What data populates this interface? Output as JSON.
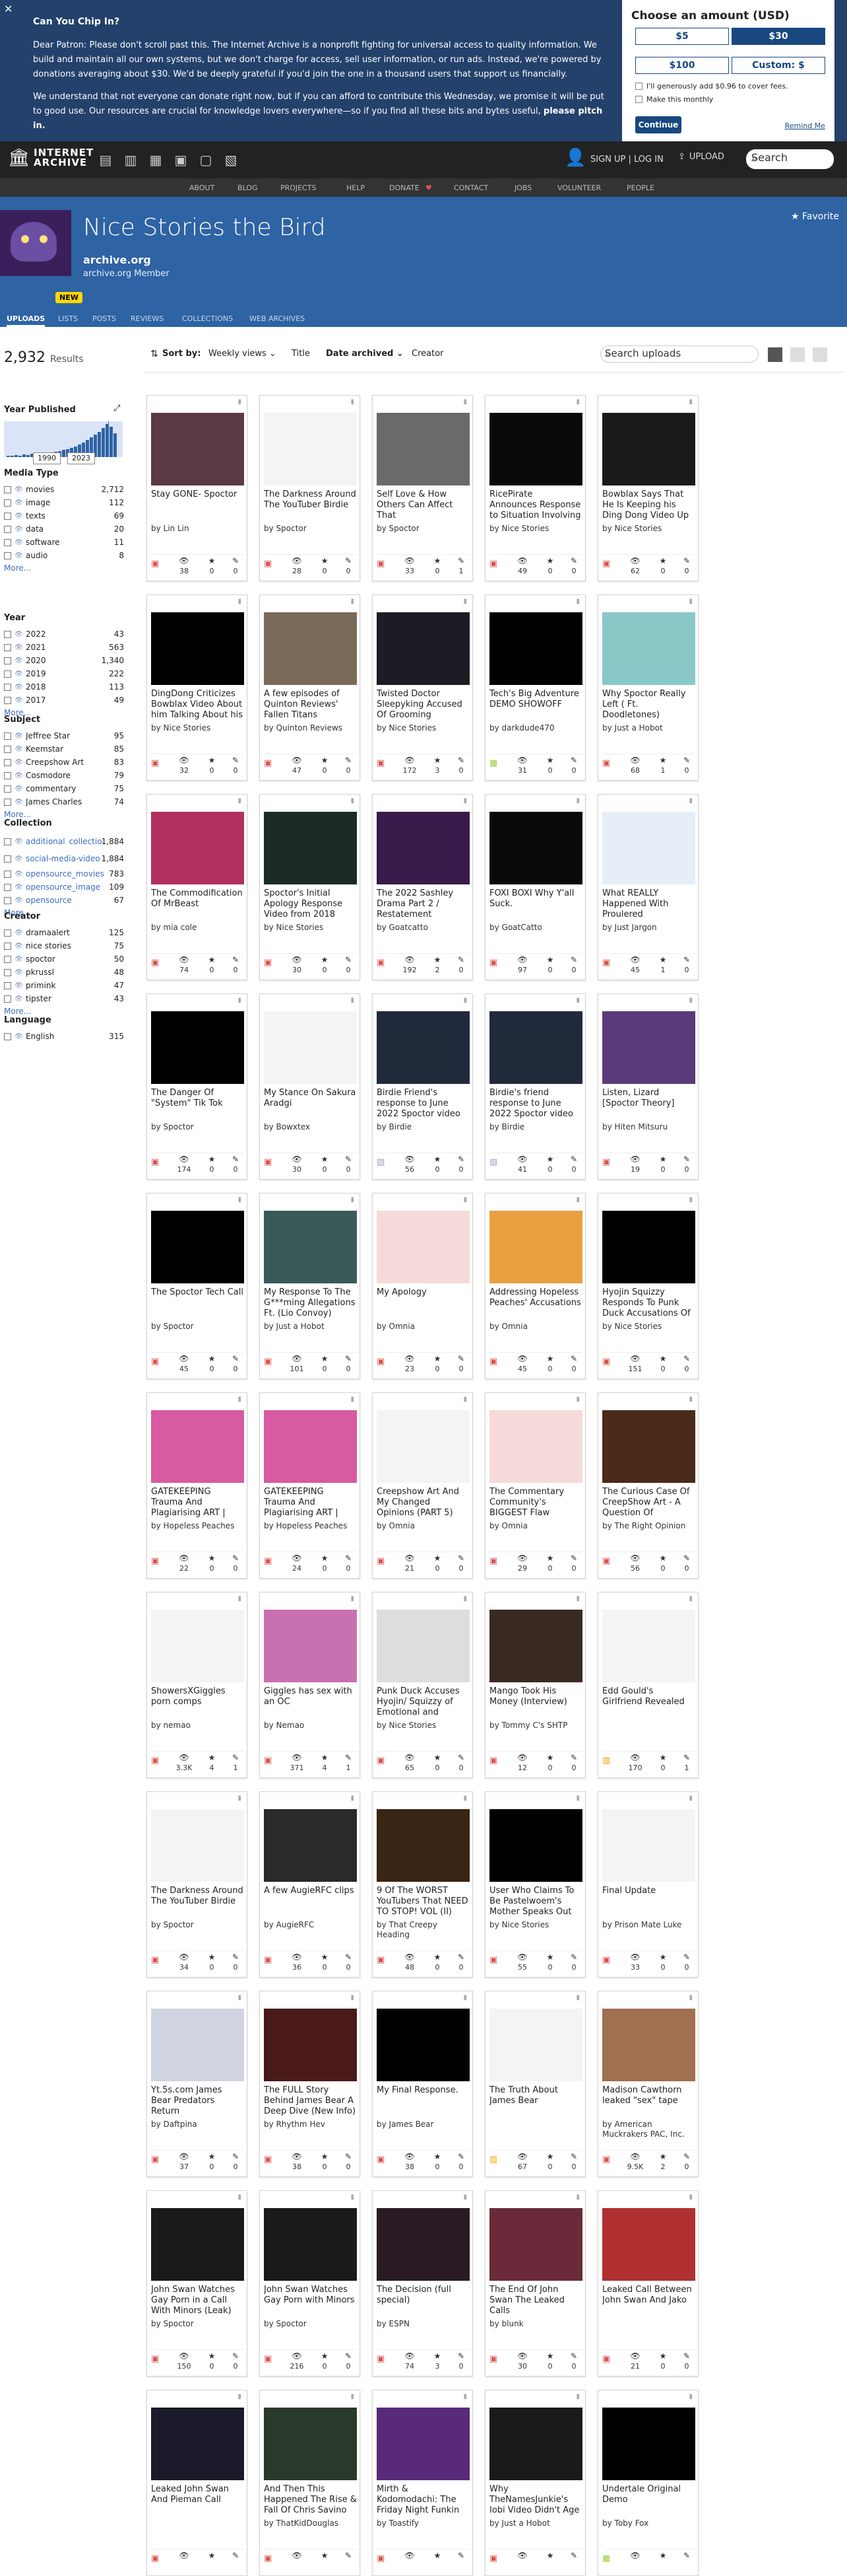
{
  "banner": {
    "close": "✕",
    "title": "Can You Chip In?",
    "p1": "Dear Patron: Please don't scroll past this. The Internet Archive is a nonprofit fighting for universal access to quality information. We build and maintain all our own systems, but we don't charge for access, sell user information, or run ads. Instead, we're powered by donations averaging about $30. We'd be deeply grateful if you'd join the one in a thousand users that support us financially.",
    "p2": "We understand that not everyone can donate right now, but if you can afford to contribute this Wednesday, we promise it will be put to good use. Our resources are crucial for knowledge lovers everywhere—so if you find all these bits and bytes useful, ",
    "p2b": "please pitch in.",
    "choose": "Choose an amount (USD)",
    "a5": "$5",
    "a30": "$30",
    "a100": "$100",
    "custom": "Custom: $",
    "fee": "I'll generously add $0.96 to cover fees.",
    "monthly": "Make this monthly",
    "continue": "Continue",
    "remind": "Remind Me"
  },
  "topbar": {
    "logo1": "INTERNET",
    "logo2": "ARCHIVE",
    "auth": "SIGN UP | LOG IN",
    "upload": "UPLOAD",
    "search": "Search"
  },
  "nav": [
    "ABOUT",
    "BLOG",
    "PROJECTS",
    "HELP",
    "DONATE",
    "CONTACT",
    "JOBS",
    "VOLUNTEER",
    "PEOPLE"
  ],
  "hero": {
    "title": "Nice Stories the Bird",
    "site": "archive.org Member",
    "favorite": "Favorite",
    "new": "NEW"
  },
  "tabs": [
    "UPLOADS",
    "LISTS",
    "POSTS",
    "REVIEWS",
    "COLLECTIONS",
    "WEB ARCHIVES"
  ],
  "results": {
    "count": "2,932",
    "label": "Results"
  },
  "sort": {
    "label": "Sort by:",
    "views": "Weekly views",
    "title": "Title",
    "date": "Date archived",
    "creator": "Creator",
    "search": "Search uploads"
  },
  "year_published": {
    "title": "Year Published",
    "from": "1990",
    "to": "2023"
  },
  "facets": {
    "media_type": {
      "title": "Media Type",
      "items": [
        [
          "movies",
          "2,712"
        ],
        [
          "image",
          "112"
        ],
        [
          "texts",
          "69"
        ],
        [
          "data",
          "20"
        ],
        [
          "software",
          "11"
        ],
        [
          "audio",
          "8"
        ]
      ]
    },
    "year": {
      "title": "Year",
      "items": [
        [
          "2022",
          "43"
        ],
        [
          "2021",
          "563"
        ],
        [
          "2020",
          "1,340"
        ],
        [
          "2019",
          "222"
        ],
        [
          "2018",
          "113"
        ],
        [
          "2017",
          "49"
        ]
      ]
    },
    "subject": {
      "title": "Subject",
      "items": [
        [
          "Jeffree Star",
          "95"
        ],
        [
          "Keemstar",
          "85"
        ],
        [
          "Creepshow Art",
          "83"
        ],
        [
          "Cosmodore",
          "79"
        ],
        [
          "commentary",
          "75"
        ],
        [
          "James Charles",
          "74"
        ]
      ]
    },
    "collection": {
      "title": "Collection",
      "items": [
        [
          "additional_collections_video",
          "1,884"
        ],
        [
          "social-media-video",
          "1,884"
        ],
        [
          "opensource_movies",
          "783"
        ],
        [
          "opensource_image",
          "109"
        ],
        [
          "opensource",
          "67"
        ]
      ]
    },
    "creator": {
      "title": "Creator",
      "items": [
        [
          "dramaalert",
          "125"
        ],
        [
          "nice stories",
          "75"
        ],
        [
          "spoctor",
          "50"
        ],
        [
          "pkrussl",
          "48"
        ],
        [
          "primink",
          "47"
        ],
        [
          "tipster",
          "43"
        ]
      ]
    },
    "language": {
      "title": "Language",
      "items": [
        [
          "English",
          "315"
        ]
      ]
    },
    "more": "More..."
  },
  "items": [
    {
      "title": "Stay GONE- Spoctor",
      "by": "by Lin Lin",
      "v": "38",
      "f": "0",
      "r": "0",
      "m": "movie",
      "bg": "#5a3a44"
    },
    {
      "title": "The Darkness Around The YouTuber Birdie",
      "by": "by Spoctor",
      "v": "28",
      "f": "0",
      "r": "0",
      "m": "movie",
      "bg": "#f4f4f4"
    },
    {
      "title": "Self Love & How Others Can Affect That",
      "by": "by Spoctor",
      "v": "33",
      "f": "0",
      "r": "1",
      "m": "movie",
      "bg": "#6a6a6a"
    },
    {
      "title": "RicePirate Announces Response to Situation Involving him, the Just Slo...",
      "by": "by Nice Stories",
      "v": "49",
      "f": "0",
      "r": "0",
      "m": "movie",
      "bg": "#0a0a0a"
    },
    {
      "title": "Bowblax Says That He Is Keeping his Ding Dong Video Up",
      "by": "by Nice Stories",
      "v": "62",
      "f": "0",
      "r": "0",
      "m": "movie",
      "bg": "#1a1a1a"
    },
    {
      "title": "DingDong Criticizes Bowblax Video About him Talking About his Experience with...",
      "by": "by Nice Stories",
      "v": "32",
      "f": "0",
      "r": "0",
      "m": "movie",
      "bg": "#000"
    },
    {
      "title": "A few episodes of Quinton Reviews' Fallen Titans",
      "by": "by Quinton Reviews",
      "v": "47",
      "f": "0",
      "r": "0",
      "m": "movie",
      "bg": "#7a6a5a"
    },
    {
      "title": "Twisted Doctor Sleepyking Accused Of Grooming Sleepking Responds",
      "by": "by Nice Stories",
      "v": "172",
      "f": "3",
      "r": "0",
      "m": "movie",
      "bg": "#1c1c24"
    },
    {
      "title": "Tech's Big Adventure DEMO SHOWOFF",
      "by": "by darkdude470",
      "v": "31",
      "f": "0",
      "r": "0",
      "m": "sw",
      "bg": "#000"
    },
    {
      "title": "Why Spoctor Really Left ( Ft. Doodletones)",
      "by": "by Just a Hobot",
      "v": "68",
      "f": "1",
      "r": "0",
      "m": "movie",
      "bg": "#8ac8c8"
    },
    {
      "title": "The Commodification Of MrBeast",
      "by": "by mia cole",
      "v": "74",
      "f": "0",
      "r": "0",
      "m": "movie",
      "bg": "#b03060"
    },
    {
      "title": "Spoctor's Initial Apology Response Video from 2018 Allegations",
      "by": "by Nice Stories",
      "v": "30",
      "f": "0",
      "r": "0",
      "m": "movie",
      "bg": "#1c2a24"
    },
    {
      "title": "The 2022 Sashley Drama Part 2 / Restatement",
      "by": "by Goatcatto",
      "v": "192",
      "f": "2",
      "r": "0",
      "m": "movie",
      "bg": "#3a1a4a"
    },
    {
      "title": "FOXI BOXI Why Y'all Suck.",
      "by": "by GoatCatto",
      "v": "97",
      "f": "0",
      "r": "0",
      "m": "movie",
      "bg": "#0a0a0a"
    },
    {
      "title": "What REALLY Happened With Proulered",
      "by": "by Just Jargon",
      "v": "45",
      "f": "1",
      "r": "0",
      "m": "movie",
      "bg": "#e8eef8"
    },
    {
      "title": "The Danger Of \"System\" Tik Tok",
      "by": "by Spoctor",
      "v": "174",
      "f": "0",
      "r": "0",
      "m": "movie",
      "bg": "#000"
    },
    {
      "title": "My Stance On Sakura Aradgi",
      "by": "by Bowxtex",
      "v": "30",
      "f": "0",
      "r": "0",
      "m": "movie",
      "bg": "#f4f4f4"
    },
    {
      "title": "Birdie Friend's response to June 2022 Spoctor video",
      "by": "by Birdie",
      "v": "56",
      "f": "0",
      "r": "0",
      "m": "image",
      "bg": "#202a3a"
    },
    {
      "title": "Birdie's friend response to June 2022 Spoctor video",
      "by": "by Birdie",
      "v": "41",
      "f": "0",
      "r": "0",
      "m": "image",
      "bg": "#202a3a"
    },
    {
      "title": "Listen, Lizard [Spoctor Theory]",
      "by": "by Hiten Mitsuru",
      "v": "19",
      "f": "0",
      "r": "0",
      "m": "movie",
      "bg": "#5a3a7a"
    },
    {
      "title": "The Spoctor Tech Call",
      "by": "by Spoctor",
      "v": "45",
      "f": "0",
      "r": "0",
      "m": "movie",
      "bg": "#000"
    },
    {
      "title": "My Response To The G***ming Allegations Ft. (Lio Convoy)",
      "by": "by Just a Hobot",
      "v": "101",
      "f": "0",
      "r": "0",
      "m": "movie",
      "bg": "#3a5a5a"
    },
    {
      "title": "My Apology",
      "by": "by Omnia",
      "v": "23",
      "f": "0",
      "r": "0",
      "m": "movie",
      "bg": "#f6dada"
    },
    {
      "title": "Addressing Hopeless Peaches' Accusations",
      "by": "by Omnia",
      "v": "45",
      "f": "0",
      "r": "0",
      "m": "movie",
      "bg": "#e8a040"
    },
    {
      "title": "Hyojin Squizzy Responds To Punk Duck Accusations Of Abuse Against Her",
      "by": "by Nice Stories",
      "v": "151",
      "f": "0",
      "r": "0",
      "m": "movie",
      "bg": "#000"
    },
    {
      "title": "GATEKEEPING Trauma And Plagiarising ART | Omnia's WORST Video",
      "by": "by Hopeless Peaches",
      "v": "22",
      "f": "0",
      "r": "0",
      "m": "movie",
      "bg": "#d85aa0"
    },
    {
      "title": "GATEKEEPING Trauma And Plagiarising ART | Omnia's WORST Video",
      "by": "by Hopeless Peaches",
      "v": "24",
      "f": "0",
      "r": "0",
      "m": "movie",
      "bg": "#d85aa0"
    },
    {
      "title": "Creepshow Art And My Changed Opinions (PART 5)",
      "by": "by Omnia",
      "v": "21",
      "f": "0",
      "r": "0",
      "m": "movie",
      "bg": "#f4f4f4"
    },
    {
      "title": "The Commentary Community's BIGGEST Flaw",
      "by": "by Omnia",
      "v": "29",
      "f": "0",
      "r": "0",
      "m": "movie",
      "bg": "#f6dada"
    },
    {
      "title": "The Curious Case Of CreepShow Art - A Question Of Character | TRO ft. Sist...",
      "by": "by The Right Opinion",
      "v": "56",
      "f": "0",
      "r": "0",
      "m": "movie",
      "bg": "#4a2a1a"
    },
    {
      "title": "ShowersXGiggles porn comps",
      "by": "by nemao",
      "v": "3.3K",
      "f": "4",
      "r": "1",
      "m": "movie",
      "bg": "#f4f4f4"
    },
    {
      "title": "Giggles has sex with an OC",
      "by": "by Nemao",
      "v": "371",
      "f": "4",
      "r": "1",
      "m": "movie",
      "bg": "#c870b0"
    },
    {
      "title": "Punk Duck Accuses Hyojin/ Squizzy of Emotional and Physical Abuse During thei...",
      "by": "by Nice Stories",
      "v": "65",
      "f": "0",
      "r": "0",
      "m": "movie",
      "bg": "#ddd"
    },
    {
      "title": "Mango Took His Money (Interview)",
      "by": "by Tommy C's SHTP",
      "v": "12",
      "f": "0",
      "r": "0",
      "m": "movie",
      "bg": "#3a2a24"
    },
    {
      "title": "Edd Gould's Girlfriend Revealed",
      "by": "",
      "v": "170",
      "f": "0",
      "r": "1",
      "m": "txt",
      "bg": "#f4f4f4"
    },
    {
      "title": "The Darkness Around The YouTuber Birdie",
      "by": "by Spoctor",
      "v": "34",
      "f": "0",
      "r": "0",
      "m": "movie",
      "bg": "#f4f4f4"
    },
    {
      "title": "A few AugieRFC clips",
      "by": "by AugieRFC",
      "v": "36",
      "f": "0",
      "r": "0",
      "m": "movie",
      "bg": "#2a2a2a"
    },
    {
      "title": "9 Of The WORST YouTubers That NEED TO STOP! VOL (II)",
      "by": "by That Creepy Heading",
      "v": "48",
      "f": "0",
      "r": "0",
      "m": "movie",
      "bg": "#3a2414"
    },
    {
      "title": "User Who Claims To Be Pastelwoem's Mother Speaks Out About...",
      "by": "by Nice Stories",
      "v": "55",
      "f": "0",
      "r": "0",
      "m": "movie",
      "bg": "#000"
    },
    {
      "title": "Final Update",
      "by": "by Prison Mate Luke",
      "v": "33",
      "f": "0",
      "r": "0",
      "m": "movie",
      "bg": "#f4f4f4"
    },
    {
      "title": "Yt.5s.com James Bear Predators Return",
      "by": "by Daftpina",
      "v": "37",
      "f": "0",
      "r": "0",
      "m": "movie",
      "bg": "#d0d4e0"
    },
    {
      "title": "The FULL Story Behind James Bear A Deep Dive (New Info)",
      "by": "by Rhythm Hev",
      "v": "38",
      "f": "0",
      "r": "0",
      "m": "movie",
      "bg": "#4a1a1a"
    },
    {
      "title": "My Final Response.",
      "by": "by James Bear",
      "v": "38",
      "f": "0",
      "r": "0",
      "m": "movie",
      "bg": "#000"
    },
    {
      "title": "The Truth About James Bear",
      "by": "",
      "v": "67",
      "f": "0",
      "r": "0",
      "m": "txt",
      "bg": "#f4f4f4"
    },
    {
      "title": "Madison Cawthorn leaked \"sex\" tape",
      "by": "by American Muckrakers PAC, Inc.",
      "v": "9.5K",
      "f": "2",
      "r": "0",
      "m": "movie",
      "bg": "#a07050"
    },
    {
      "title": "John Swan Watches Gay Porn in a Call With Minors (Leak)",
      "by": "by Spoctor",
      "v": "150",
      "f": "0",
      "r": "0",
      "m": "movie",
      "bg": "#1a1a1a"
    },
    {
      "title": "John Swan Watches Gay Porn with Minors",
      "by": "by Spoctor",
      "v": "216",
      "f": "0",
      "r": "0",
      "m": "movie",
      "bg": "#1a1a1a"
    },
    {
      "title": "The Decision (full special)",
      "by": "by ESPN",
      "v": "74",
      "f": "3",
      "r": "0",
      "m": "movie",
      "bg": "#2a1a24"
    },
    {
      "title": "The End Of John Swan The Leaked Calls",
      "by": "by blunk",
      "v": "30",
      "f": "0",
      "r": "0",
      "m": "movie",
      "bg": "#6a2a3a"
    },
    {
      "title": "Leaked Call Between John Swan And Jako",
      "by": "",
      "v": "21",
      "f": "0",
      "r": "0",
      "m": "movie",
      "bg": "#b03030"
    },
    {
      "title": "Leaked John Swan And Pieman Call",
      "by": "",
      "v": "",
      "f": "",
      "r": "",
      "m": "movie",
      "bg": "#1a1a2a"
    },
    {
      "title": "And Then This Happened The Rise & Fall Of Chris Savino",
      "by": "by ThatKidDouglas",
      "v": "",
      "f": "",
      "r": "",
      "m": "movie",
      "bg": "#2a3a2a"
    },
    {
      "title": "Mirth & Kodomodachi: The Friday Night Funkin Creator Who Got Away With It",
      "by": "by Toastify",
      "v": "",
      "f": "",
      "r": "",
      "m": "movie",
      "bg": "#5a2a7a"
    },
    {
      "title": "Why TheNamesJunkie's Iobi Video Didn't Age Well (Ft. Doodletones)",
      "by": "by Just a Hobot",
      "v": "",
      "f": "",
      "r": "",
      "m": "movie",
      "bg": "#1a1a1a"
    },
    {
      "title": "Undertale Original Demo",
      "by": "by Toby Fox",
      "v": "",
      "f": "",
      "r": "",
      "m": "sw",
      "bg": "#000"
    }
  ]
}
